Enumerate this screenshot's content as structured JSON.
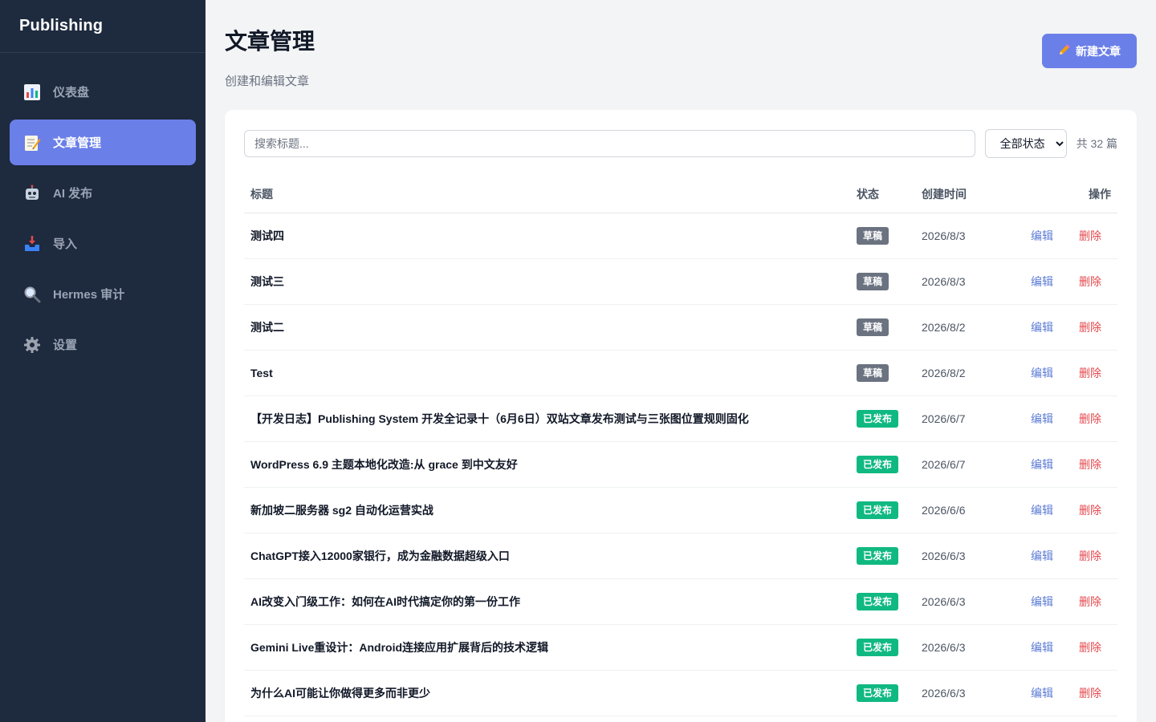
{
  "sidebar": {
    "brand": "Publishing",
    "items": [
      {
        "label": "仪表盘",
        "icon": "bar-chart-icon",
        "active": false
      },
      {
        "label": "文章管理",
        "icon": "memo-icon",
        "active": true
      },
      {
        "label": "AI 发布",
        "icon": "robot-icon",
        "active": false
      },
      {
        "label": "导入",
        "icon": "inbox-tray-icon",
        "active": false
      },
      {
        "label": "Hermes 审计",
        "icon": "magnifier-icon",
        "active": false
      },
      {
        "label": "设置",
        "icon": "gear-icon",
        "active": false
      }
    ]
  },
  "header": {
    "title": "文章管理",
    "subtitle": "创建和编辑文章",
    "new_button_icon": "pencil-icon",
    "new_button_label": "新建文章"
  },
  "toolbar": {
    "search_placeholder": "搜索标题...",
    "status_selected": "全部状态",
    "count_label": "共 32 篇"
  },
  "table": {
    "columns": {
      "title": "标题",
      "status": "状态",
      "created": "创建时间",
      "ops": "操作"
    },
    "edit_label": "编辑",
    "delete_label": "删除",
    "rows": [
      {
        "title": "测试四",
        "status": "草稿",
        "status_type": "draft",
        "date": "2026/8/3"
      },
      {
        "title": "测试三",
        "status": "草稿",
        "status_type": "draft",
        "date": "2026/8/3"
      },
      {
        "title": "测试二",
        "status": "草稿",
        "status_type": "draft",
        "date": "2026/8/2"
      },
      {
        "title": "Test",
        "status": "草稿",
        "status_type": "draft",
        "date": "2026/8/2"
      },
      {
        "title": "【开发日志】Publishing System 开发全记录十（6月6日）双站文章发布测试与三张图位置规则固化",
        "status": "已发布",
        "status_type": "published",
        "date": "2026/6/7"
      },
      {
        "title": "WordPress 6.9 主题本地化改造:从 grace 到中文友好",
        "status": "已发布",
        "status_type": "published",
        "date": "2026/6/7"
      },
      {
        "title": "新加坡二服务器 sg2 自动化运营实战",
        "status": "已发布",
        "status_type": "published",
        "date": "2026/6/6"
      },
      {
        "title": "ChatGPT接入12000家银行，成为金融数据超级入口",
        "status": "已发布",
        "status_type": "published",
        "date": "2026/6/3"
      },
      {
        "title": "AI改变入门级工作：如何在AI时代搞定你的第一份工作",
        "status": "已发布",
        "status_type": "published",
        "date": "2026/6/3"
      },
      {
        "title": "Gemini Live重设计：Android连接应用扩展背后的技术逻辑",
        "status": "已发布",
        "status_type": "published",
        "date": "2026/6/3"
      },
      {
        "title": "为什么AI可能让你做得更多而非更少",
        "status": "已发布",
        "status_type": "published",
        "date": "2026/6/3"
      }
    ]
  },
  "colors": {
    "sidebar_bg": "#1e2a3e",
    "accent": "#6b7fe8",
    "draft": "#6b7280",
    "published": "#10b981",
    "edit_link": "#5b7bd5",
    "delete_link": "#e5484d"
  }
}
